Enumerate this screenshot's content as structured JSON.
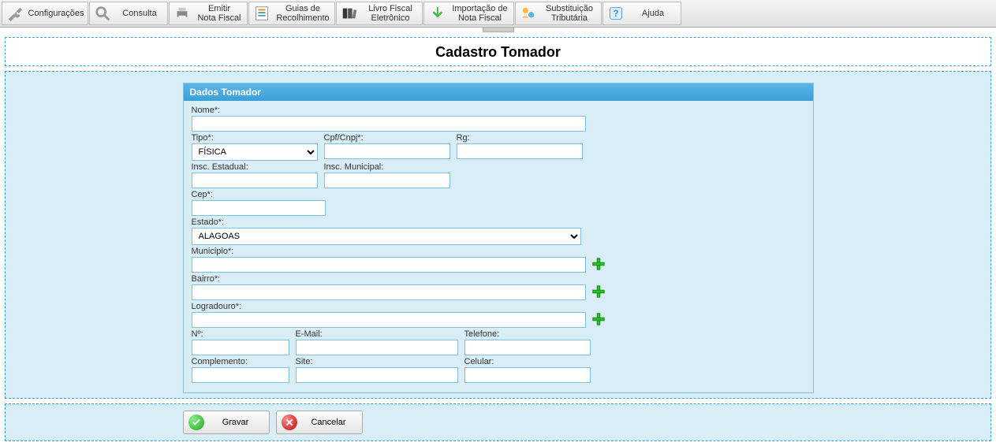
{
  "toolbar": {
    "configuracoes": "Configurações",
    "consulta": "Consulta",
    "emitir_nf": "Emitir\nNota Fiscal",
    "guias": "Guias de\nRecolhimento",
    "livro": "Livro Fiscal\nEletrônico",
    "importacao": "Importação de\nNota Fiscal",
    "substituicao": "Substituição\nTributária",
    "ajuda": "Ajuda"
  },
  "page": {
    "title": "Cadastro Tomador"
  },
  "panel": {
    "title": "Dados Tomador"
  },
  "labels": {
    "nome": "Nome*:",
    "tipo": "Tipo*:",
    "cpfcnpj": "Cpf/Cnpj*:",
    "rg": "Rg:",
    "insc_estadual": "Insc. Estadual:",
    "insc_municipal": "Insc. Municipal:",
    "cep": "Cep*:",
    "estado": "Estado*:",
    "municipio": "Municipio*:",
    "bairro": "Bairro*:",
    "logradouro": "Logradouro*:",
    "numero": "Nº:",
    "email": "E-Mail:",
    "telefone": "Telefone:",
    "complemento": "Complemento:",
    "site": "Site:",
    "celular": "Celular:"
  },
  "values": {
    "tipo": "FÍSICA",
    "estado": "ALAGOAS"
  },
  "buttons": {
    "gravar": "Gravar",
    "cancelar": "Cancelar"
  }
}
